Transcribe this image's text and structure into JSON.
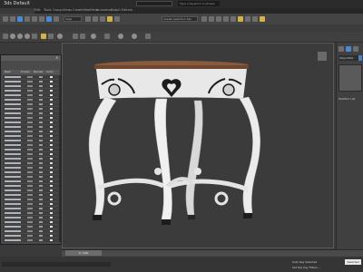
{
  "window": {
    "title": "3ds Default"
  },
  "menu": {
    "items": [
      "Edit",
      "Tools",
      "Group",
      "Views",
      "Create",
      "Modifiers",
      "Animation",
      "Graph Editors",
      "Rendering",
      "Customize",
      "Scripting",
      "Help"
    ]
  },
  "search": {
    "placeholder": "Type a keyword or phrase"
  },
  "toolbar": {
    "view_dropdown": "View",
    "selection_set": "Create Selection Set"
  },
  "scene_explorer": {
    "close_label": "×",
    "columns": [
      "Nam",
      "Frozen",
      "Render",
      "Color"
    ]
  },
  "command_panel": {
    "object_name": "Object001",
    "section_label": "Modifier List"
  },
  "timeline": {
    "frame": "0 / 100"
  },
  "status": {
    "line1": "Auto Key  Selected",
    "line2": "Set Key  Key Filters...",
    "anim_button": "Selected"
  },
  "colors": {
    "accent": "#4a8ad0",
    "table_body": "#e8e8e8",
    "table_wood": "#8a5a3c"
  }
}
